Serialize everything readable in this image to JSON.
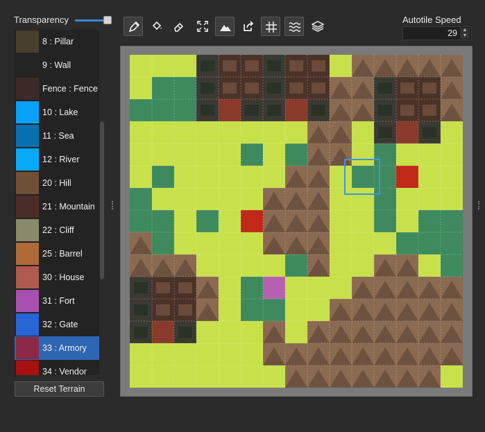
{
  "transparency": {
    "label": "Transparency",
    "value": 0.85
  },
  "terrain_list": {
    "items": [
      {
        "label": "8 : Pillar",
        "color": "#48402c"
      },
      {
        "label": "9 : Wall",
        "color": "#242424"
      },
      {
        "label": "Fence : Fence",
        "color": "#3c2a28"
      },
      {
        "label": "10 : Lake",
        "color": "#08a0f8"
      },
      {
        "label": "11 : Sea",
        "color": "#0870b0"
      },
      {
        "label": "12 : River",
        "color": "#08a8f8"
      },
      {
        "label": "20 : Hill",
        "color": "#6e5034"
      },
      {
        "label": "21 : Mountain",
        "color": "#4c2c26"
      },
      {
        "label": "22 : Cliff",
        "color": "#8a8a6a"
      },
      {
        "label": "25 : Barrel",
        "color": "#b06a38"
      },
      {
        "label": "30 : House",
        "color": "#b05a50"
      },
      {
        "label": "31 : Fort",
        "color": "#a850b0"
      },
      {
        "label": "32 : Gate",
        "color": "#2866d8"
      },
      {
        "label": "33 : Armory",
        "color": "#8c2848",
        "selected": true
      },
      {
        "label": "34 : Vendor",
        "color": "#a81010"
      }
    ],
    "selected_color": "#2f66b3"
  },
  "reset_button": {
    "label": "Reset Terrain"
  },
  "toolbar": {
    "tools": [
      {
        "icon": "pen-icon",
        "active": true
      },
      {
        "icon": "fill-bucket-icon",
        "active": false
      },
      {
        "icon": "eraser-icon",
        "active": false
      },
      {
        "icon": "fullscreen-icon",
        "active": false
      },
      {
        "icon": "terrain-mountain-icon",
        "active": true
      },
      {
        "icon": "export-icon",
        "active": false
      },
      {
        "icon": "grid-icon",
        "active": true
      },
      {
        "icon": "water-waves-icon",
        "active": true
      },
      {
        "icon": "layers-icon",
        "active": false
      }
    ]
  },
  "autotile": {
    "label": "Autotile Speed",
    "value": "29"
  },
  "map": {
    "rows": 15,
    "cols": 15,
    "tiles": [
      "GGGHTTHTTGMMMMM",
      "GFFHTTHTTMMHTTM",
      "FFFHDHHDHMMHTTM",
      "GGGGGGGGMMGHDHG",
      "GGGGGFGFMMGFGGG",
      "GFGGGGGMMGFFVGG",
      "FGGGGGMMMGGFGGG",
      "FFGFGVMMMGGFGFF",
      "MFGGGGMMMGGGFFF",
      "MMMGGGGFMGGMMGF",
      "HTTMGFAGGGMMMMM",
      "HTTMGFFGGMMMMMM",
      "HDHGGGMGMMMMMMM",
      "GGGGGGMMMMMMMMM",
      "GGGGGGGMMMMMMMG"
    ],
    "legend": {
      "G": "#c8e04a",
      "F": "#3e8a5e",
      "M": "#8a6a50",
      "H": "#3a3a32",
      "T": "#4a3228",
      "D": "#8a3a2a",
      "V": "#c02818",
      "A": "#b860b0"
    }
  }
}
